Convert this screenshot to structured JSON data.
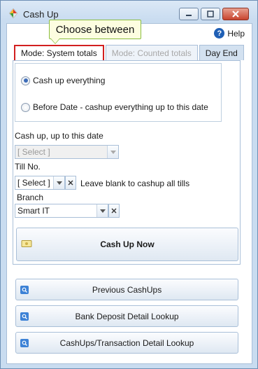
{
  "window": {
    "title": "Cash Up"
  },
  "help": {
    "label": "Help"
  },
  "tooltip": {
    "text": "Choose between"
  },
  "tabs": [
    {
      "label": "Mode: System totals",
      "state": "active"
    },
    {
      "label": "Mode: Counted totals",
      "state": "disabled"
    },
    {
      "label": "Day End",
      "state": "normal"
    }
  ],
  "options": {
    "cash_up_everything": "Cash up everything",
    "before_date": "Before Date - cashup everything up to this date",
    "selected": "cash_up_everything"
  },
  "date_field": {
    "label": "Cash up, up to this date",
    "value": "[ Select ]"
  },
  "till_field": {
    "label": "Till No.",
    "value": "[ Select ]",
    "hint": "Leave blank to cashup all tills"
  },
  "branch_field": {
    "label": "Branch",
    "value": "Smart IT"
  },
  "buttons": {
    "cash_up_now": "Cash Up Now",
    "previous": "Previous CashUps",
    "bank_deposit": "Bank Deposit Detail Lookup",
    "transaction": "CashUps/Transaction Detail Lookup"
  },
  "colors": {
    "accent": "#d21f1f",
    "tooltip_border": "#8abd3d",
    "chrome": "#c9dcf0"
  }
}
